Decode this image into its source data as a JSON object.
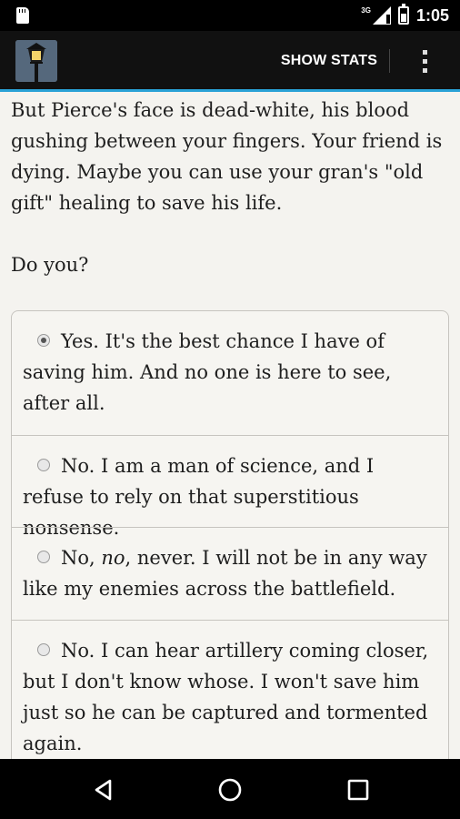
{
  "status_bar": {
    "network_type": "3G",
    "time": "1:05",
    "icons": [
      "sd-card-icon",
      "signal-icon",
      "battery-icon"
    ]
  },
  "action_bar": {
    "app_icon": "lamp-post-icon",
    "show_stats_label": "SHOW STATS",
    "overflow_icon": "overflow-menu-icon",
    "accent_color": "#2aa2d6"
  },
  "content": {
    "passage": "But Pierce's face is dead-white, his blood gushing between your fingers. Your friend is dying. Maybe you can use your gran's \"old gift\" healing to save his life.",
    "question": "Do you?",
    "choices": [
      {
        "text": "Yes. It's the best chance I have of saving him. And no one is here to see, after all.",
        "selected": true
      },
      {
        "text": "No. I am a man of science, and I refuse to rely on that superstitious nonsense.",
        "selected": false
      },
      {
        "text_before": "No, ",
        "text_emphasis": "no",
        "text_after": ", never. I will not be in any way like my enemies across the battlefield.",
        "selected": false
      },
      {
        "text": "No. I can hear artillery coming closer, but I don't know whose. I won't save him just so he can be captured and tormented again.",
        "selected": false
      }
    ]
  },
  "nav_bar": {
    "buttons": [
      "back-icon",
      "home-icon",
      "recents-icon"
    ]
  }
}
